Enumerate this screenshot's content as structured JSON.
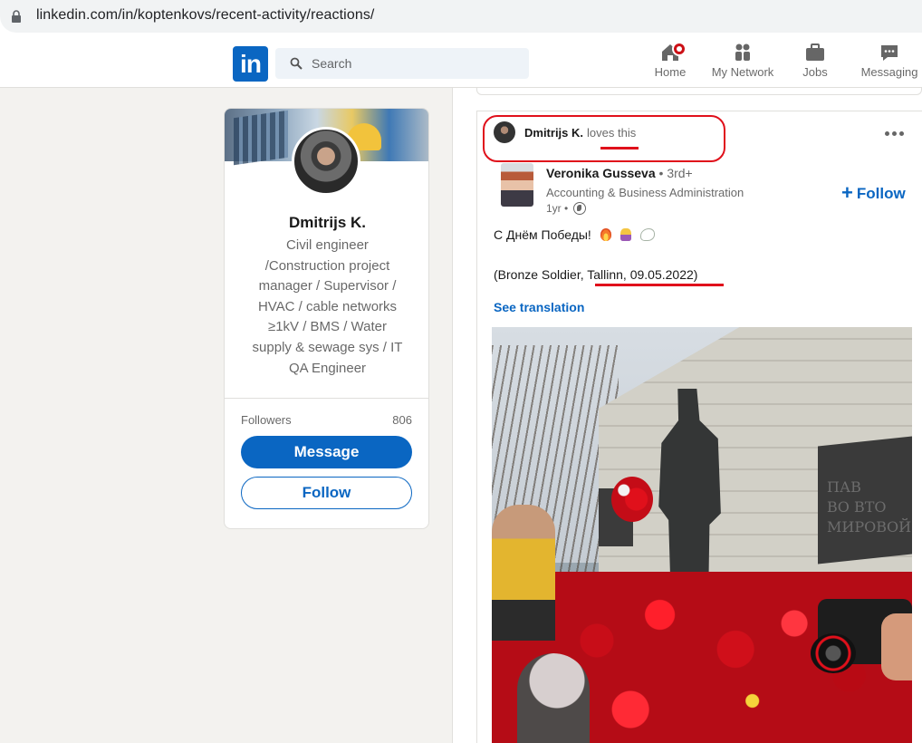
{
  "browser": {
    "url": "linkedin.com/in/koptenkovs/recent-activity/reactions/"
  },
  "header": {
    "logo": "in",
    "search_placeholder": "Search",
    "nav": {
      "home": "Home",
      "my_network": "My Network",
      "jobs": "Jobs",
      "messaging": "Messaging"
    }
  },
  "profile": {
    "name": "Dmitrijs K.",
    "headline": "Civil engineer /Construction project manager / Supervisor / HVAC / cable networks ≥1kV / BMS / Water supply & sewage sys / IT QA Engineer",
    "followers_label": "Followers",
    "followers_count": "806",
    "message_label": "Message",
    "follow_label": "Follow"
  },
  "post": {
    "activity_actor": "Dmitrijs K.",
    "activity_action": "loves this",
    "author_name": "Veronika Gusseva",
    "author_degree": "• 3rd+",
    "author_headline": "Accounting & Business Administration",
    "author_time": "1yr •",
    "follow_label": "Follow",
    "text_line1": "С Днём Победы!",
    "text_line2": "(Bronze Soldier, Tallinn, 09.05.2022)",
    "see_translation": "See translation",
    "image_text": [
      "ПАВ",
      "ВО ВТО",
      "МИРОВОЙ"
    ]
  },
  "colors": {
    "brand": "#0a66c2",
    "annotation": "#e0101b",
    "notification": "#cc1016"
  },
  "icons": [
    "lock-icon",
    "search-icon",
    "home-icon",
    "network-icon",
    "jobs-icon",
    "messaging-icon",
    "more-icon",
    "globe-icon",
    "plus-icon"
  ]
}
